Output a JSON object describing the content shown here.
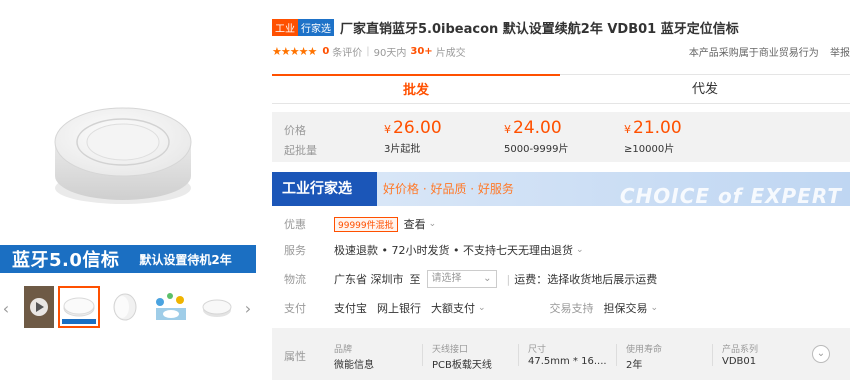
{
  "gallery": {
    "banner_big": "蓝牙5.0信标",
    "banner_small": "默认设置待机2年",
    "prev_icon": "chevron-left-icon",
    "next_icon": "chevron-right-icon"
  },
  "title": {
    "tag_industry": "工业",
    "tag_select": "行家选",
    "text": "厂家直销蓝牙5.0ibeacon 默认设置续航2年 VDB01 蓝牙定位信标"
  },
  "meta": {
    "stars": "★★★★★",
    "review_count": "0",
    "review_label": "条评价",
    "days_label": "90天内",
    "deal_count": "30+",
    "deal_label": "片成交",
    "notice": "本产品采购属于商业贸易行为",
    "report": "举报"
  },
  "tabs": [
    {
      "label": "批发",
      "active": true
    },
    {
      "label": "代发",
      "active": false
    }
  ],
  "price": {
    "price_label": "价格",
    "moq_label": "起批量",
    "currency": "¥",
    "tiers": [
      {
        "value": "26.00",
        "qty": "3片起批"
      },
      {
        "value": "24.00",
        "qty": "5000-9999片"
      },
      {
        "value": "21.00",
        "qty": "≥10000片"
      }
    ]
  },
  "promo": {
    "left": "工业行家选",
    "right": "好价格 · 好品质 · 好服务",
    "watermark": "CHOICE of EXPERT"
  },
  "offer": {
    "label": "优惠",
    "badge": "99999件混批",
    "link": "查看"
  },
  "service": {
    "label": "服务",
    "text": "极速退款 • 72小时发货 • 不支持七天无理由退货"
  },
  "logistics": {
    "label": "物流",
    "from": "广东省 深圳市",
    "to": "至",
    "select_placeholder": "请选择",
    "freight": "运费：选择收货地后展示运费"
  },
  "payment": {
    "label": "支付",
    "methods": [
      "支付宝",
      "网上银行",
      "大额支付"
    ],
    "trade_label": "交易支持",
    "trade_value": "担保交易"
  },
  "attributes": {
    "label": "属性",
    "items": [
      {
        "k": "品牌",
        "v": "微能信息"
      },
      {
        "k": "天线接口",
        "v": "PCB板载天线"
      },
      {
        "k": "尺寸",
        "v": "47.5mm * 16...."
      },
      {
        "k": "使用寿命",
        "v": "2年"
      },
      {
        "k": "产品系列",
        "v": "VDB01"
      }
    ]
  }
}
